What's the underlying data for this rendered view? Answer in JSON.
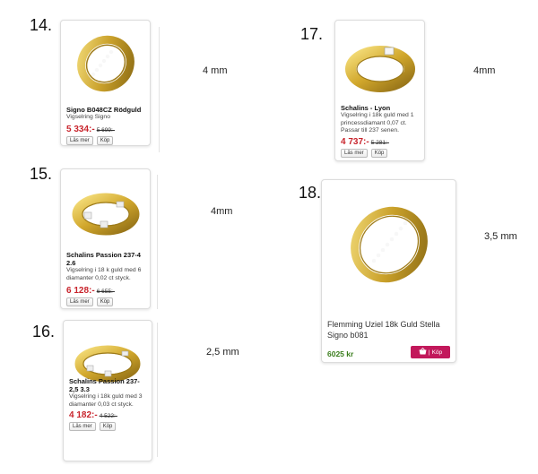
{
  "products": [
    {
      "number": "14.",
      "title": "Signo B048CZ Rödguld",
      "desc": "Vigselring Signo",
      "price": "5 334:-",
      "old_price": "5 699:-",
      "size": "4 mm",
      "more": "Läs mer",
      "buy": "Köp"
    },
    {
      "number": "15.",
      "title": "Schalins Passion 237-4 2.6",
      "desc": "Vigselring i 18 k guld med 6 diamanter 0,02 ct styck.",
      "price": "6 128:-",
      "old_price": "6 655:-",
      "size": "4mm",
      "more": "Läs mer",
      "buy": "Köp"
    },
    {
      "number": "16.",
      "title": "Schalins Passion 237-2,5 3.3",
      "desc": "Vigselring i 18k guld med 3 diamanter 0,03 ct styck.",
      "price": "4 182:-",
      "old_price": "4 522:-",
      "size": "2,5 mm",
      "more": "Läs mer",
      "buy": "Köp"
    },
    {
      "number": "17.",
      "title": "Schalins - Lyon",
      "desc": "Vigselring i 18k guld med 1 princessdiamant 0,07 ct. Passar till 237 senen.",
      "price": "4 737:-",
      "old_price": "5 281:-",
      "size": "4mm",
      "more": "Läs mer",
      "buy": "Köp"
    },
    {
      "number": "18.",
      "title": "Flemming Uziel 18k Guld Stella Signo b081",
      "price": "6025 kr",
      "size": "3,5 mm",
      "buy": "Köp"
    }
  ],
  "colors": {
    "gold": "#d8b43a",
    "price_red": "#c8242c",
    "price_green": "#3a7d1c",
    "cart_pink": "#c2185b"
  },
  "icons": {
    "cart": "basket-icon"
  }
}
